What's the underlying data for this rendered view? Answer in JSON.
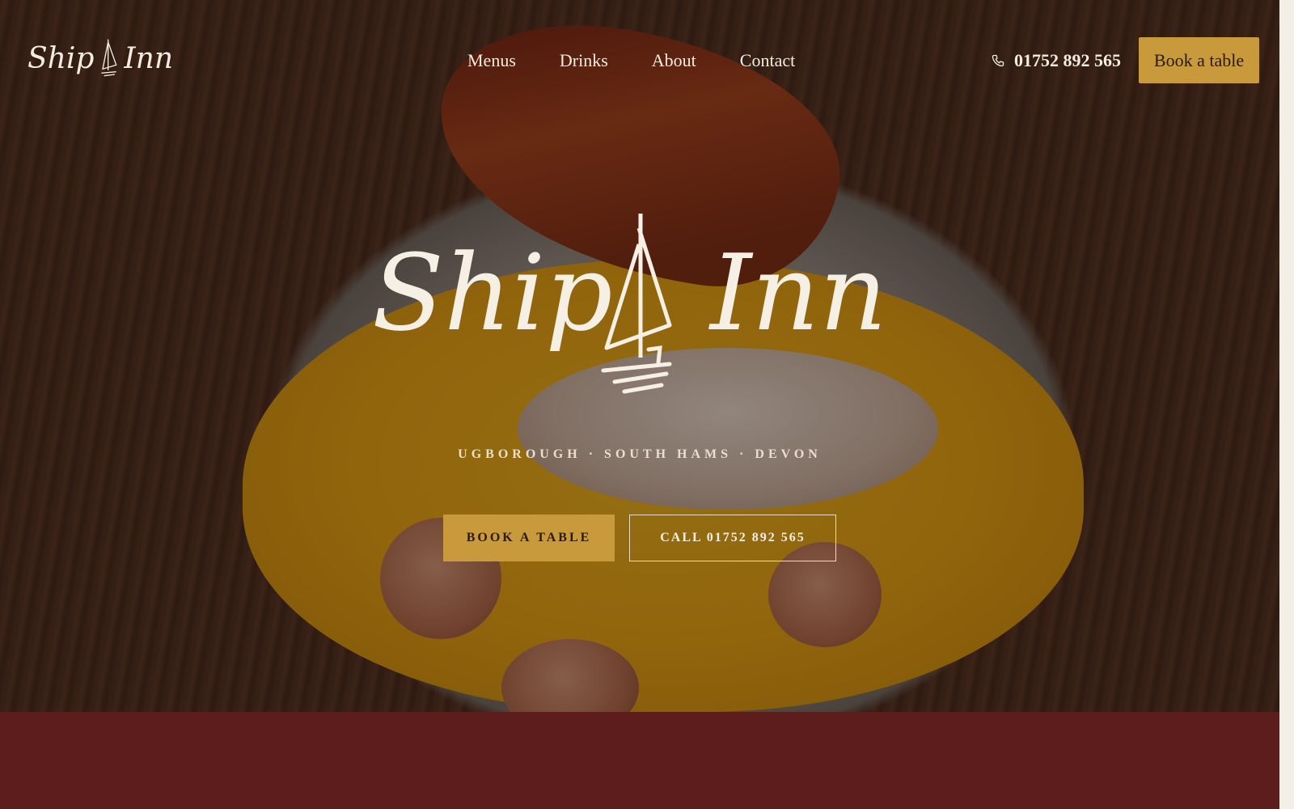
{
  "brand": {
    "name_part1": "Ship",
    "name_part2": "Inn"
  },
  "nav": {
    "items": [
      "Menus",
      "Drinks",
      "About",
      "Contact"
    ]
  },
  "header": {
    "phone": "01752 892 565",
    "book_label": "Book a table"
  },
  "hero": {
    "tagline": "UGBOROUGH · SOUTH HAMS · DEVON",
    "cta_book": "BOOK A TABLE",
    "cta_call": "CALL 01752 892 565"
  },
  "colors": {
    "accent_gold": "#c99a3b",
    "band_maroon": "#5e1d1d",
    "cream": "#f4ece0"
  },
  "icons": {
    "phone": "phone-icon",
    "boat": "sailboat-icon"
  }
}
